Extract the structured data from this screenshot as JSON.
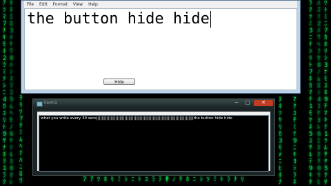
{
  "notepad": {
    "menu": [
      "File",
      "Edit",
      "Format",
      "View",
      "Help"
    ],
    "text": "the button hide hide"
  },
  "form": {
    "title": "Form1",
    "textbox": {
      "prefix": "what you write every 30 secs",
      "masked": "||||||||||||||||||||||||||||||||||||||||||||||||||||||||||||||||||||||||||||",
      "suffix": "the button hide hide"
    },
    "hide_button": "Hide",
    "controls": {
      "minimize": "─",
      "maximize": "□",
      "close": "✕"
    }
  },
  "colors": {
    "matrix": "#16d33a",
    "close": "#c23b22"
  }
}
